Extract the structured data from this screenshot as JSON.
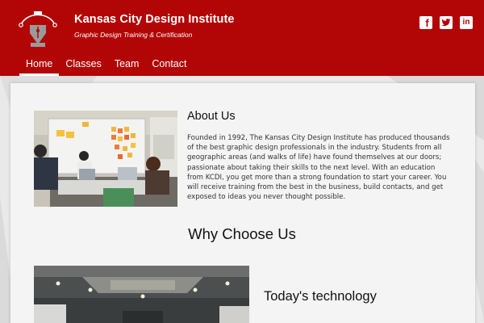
{
  "brand": {
    "title": "Kansas City Design Institute",
    "subtitle": "Graphic Design Training & Certification",
    "logo": "pen-nib-logo"
  },
  "social": [
    {
      "name": "facebook-icon",
      "glyph": "f"
    },
    {
      "name": "twitter-icon",
      "glyph": "t"
    },
    {
      "name": "linkedin-icon",
      "glyph": "in"
    }
  ],
  "nav": {
    "items": [
      "Home",
      "Classes",
      "Team",
      "Contact"
    ],
    "active": "Home"
  },
  "about": {
    "title": "About Us",
    "body": "Founded in 1992, The Kansas City Design Institute has produced thousands of the best graphic design professionals in the industry. Students from all geographic areas (and walks of life) have found themselves at our doors; passionate about taking their skills to the next level. With an education from KCDI, you get more than a strong foundation to start your career. You will receive training from the best in the business, build contacts, and get exposed to ideas you never thought possible."
  },
  "why": {
    "title": "Why Choose Us",
    "feature_title": "Today's technology"
  },
  "colors": {
    "header": "#b20606",
    "card": "#f4f4f4",
    "page_bg": "#e9e9e9"
  }
}
